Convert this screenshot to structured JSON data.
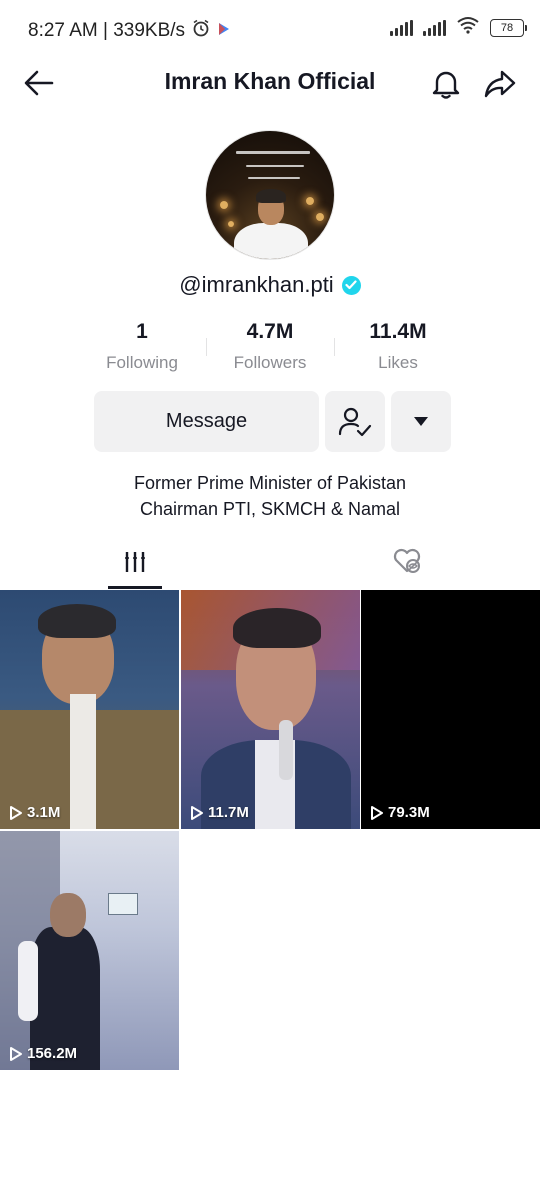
{
  "status_bar": {
    "time_speed": "8:27 AM | 339KB/s",
    "alarm_icon": "alarm-clock-icon",
    "battery": "78"
  },
  "header": {
    "title": "Imran Khan Official",
    "back_icon": "arrow-left-icon",
    "bell_icon": "bell-icon",
    "share_icon": "share-arrow-icon"
  },
  "profile": {
    "handle": "@imrankhan.pti",
    "verified": true
  },
  "stats": [
    {
      "value": "1",
      "label": "Following"
    },
    {
      "value": "4.7M",
      "label": "Followers"
    },
    {
      "value": "11.4M",
      "label": "Likes"
    }
  ],
  "actions": {
    "message_label": "Message",
    "follow_icon": "user-check-icon",
    "more_icon": "caret-down-icon"
  },
  "bio": {
    "line1": "Former Prime Minister of Pakistan",
    "line2": "Chairman PTI, SKMCH & Namal"
  },
  "tabs": {
    "videos_icon": "grid-bars-icon",
    "liked_icon": "heart-hidden-icon",
    "active": "videos"
  },
  "videos": [
    {
      "views": "3.1M"
    },
    {
      "views": "11.7M"
    },
    {
      "views": "79.3M"
    },
    {
      "views": "156.2M"
    }
  ],
  "colors": {
    "primary_text": "#161823",
    "secondary_text": "#8a8b91",
    "button_bg": "#f1f1f2",
    "verified": "#20d5ec"
  }
}
